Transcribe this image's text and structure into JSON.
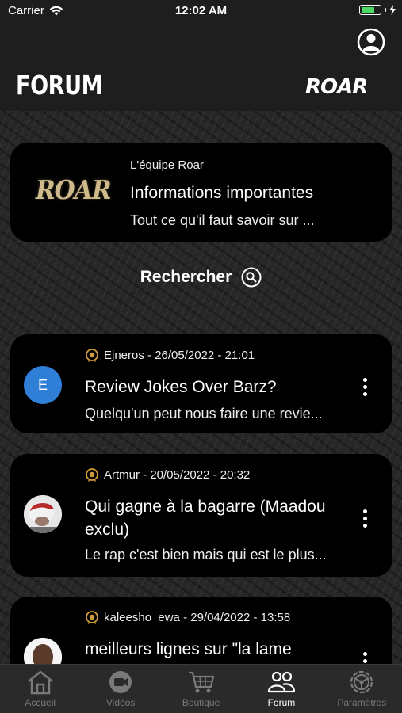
{
  "status_bar": {
    "carrier": "Carrier",
    "time": "12:02 AM"
  },
  "header": {
    "title": "FORUM",
    "logo": "ROAR"
  },
  "announcement": {
    "logo": "ROAR",
    "author": "L'équipe Roar",
    "title": "Informations importantes",
    "excerpt": "Tout ce qu'il faut savoir sur ..."
  },
  "search": {
    "label": "Rechercher"
  },
  "posts": [
    {
      "author": "Ejneros",
      "date": " - 26/05/2022 - 21:01",
      "avatar_letter": "E",
      "title": "Review Jokes Over Barz?",
      "excerpt": "Quelqu'un peut nous faire une revie..."
    },
    {
      "author": "Artmur",
      "date": " - 20/05/2022 - 20:32",
      "title": "Qui gagne à la bagarre (Maadou exclu)",
      "excerpt": "Le rap c'est bien mais qui est le plus..."
    },
    {
      "author": "kaleesho_ewa",
      "date": " - 29/04/2022 - 13:58",
      "title": "meilleurs lignes sur  \"la lame",
      "excerpt": ""
    }
  ],
  "tabbar": {
    "items": [
      {
        "label": "Accueil",
        "icon": "home-icon"
      },
      {
        "label": "Vidéos",
        "icon": "video-icon"
      },
      {
        "label": "Boutique",
        "icon": "cart-icon"
      },
      {
        "label": "Forum",
        "icon": "users-icon",
        "active": true
      },
      {
        "label": "Paramètres",
        "icon": "gear-icon"
      }
    ]
  },
  "colors": {
    "background": "#262626",
    "card": "#000000",
    "avatar_blue": "#2f7fd6",
    "logo_gold": "#cdb98a",
    "battery": "#4cd964",
    "badge_gold": "#d19a3a"
  }
}
